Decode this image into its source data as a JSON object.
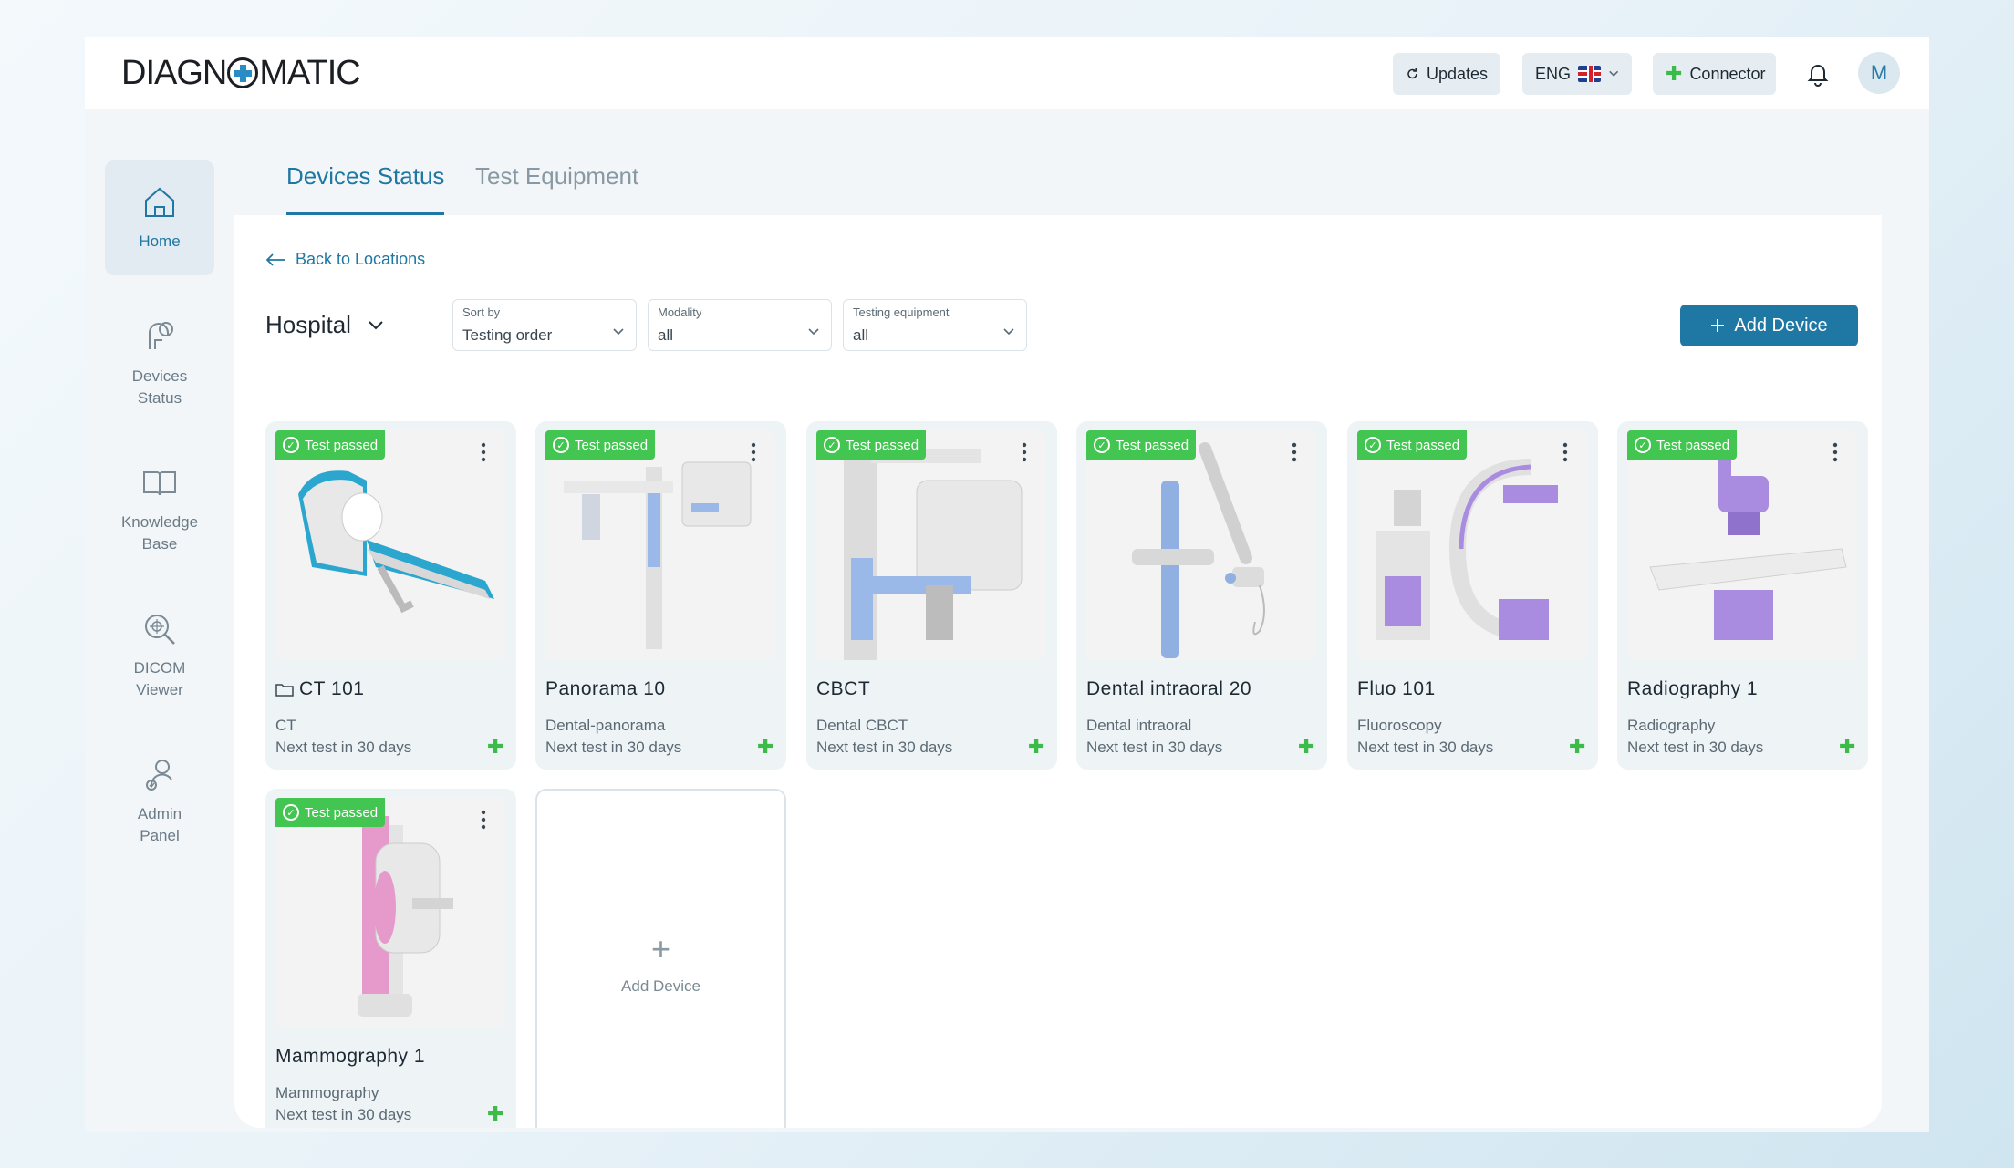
{
  "app": {
    "logo": "DIAGNOMATIC",
    "logo_prefix": "DIAGN",
    "logo_suffix": "MATIC"
  },
  "topbar": {
    "updates_label": "Updates",
    "lang_label": "ENG",
    "connector_label": "Connector",
    "avatar_initial": "M"
  },
  "sidebar": {
    "items": [
      {
        "label": "Home",
        "icon": "home-icon"
      },
      {
        "label": "Devices Status",
        "icon": "devices-status-icon"
      },
      {
        "label": "Knowledge Base",
        "icon": "book-icon"
      },
      {
        "label": "DICOM Viewer",
        "icon": "dicom-viewer-icon"
      },
      {
        "label": "Admin Panel",
        "icon": "admin-panel-icon"
      }
    ]
  },
  "tabs": [
    "Devices Status",
    "Test Equipment"
  ],
  "back_link": "Back to Locations",
  "location": "Hospital",
  "filters": {
    "sort_by": {
      "label": "Sort by",
      "value": "Testing order"
    },
    "modality": {
      "label": "Modality",
      "value": "all"
    },
    "testing_equipment": {
      "label": "Testing equipment",
      "value": "all"
    }
  },
  "add_device_button": "Add Device",
  "devices": [
    {
      "name": "CT 101",
      "modality": "CT",
      "next_test": "Next test in 30 days",
      "status": "Test passed",
      "accent": "#2ba6cf"
    },
    {
      "name": "Panorama 10",
      "modality": "Dental-panorama",
      "next_test": "Next test in 30 days",
      "status": "Test passed",
      "accent": "#7ea6e0"
    },
    {
      "name": "CBCT",
      "modality": "Dental CBCT",
      "next_test": "Next test in 30 days",
      "status": "Test passed",
      "accent": "#8fb0e0"
    },
    {
      "name": "Dental intraoral 20",
      "modality": "Dental intraoral",
      "next_test": "Next test in 30 days",
      "status": "Test passed",
      "accent": "#8fb0e0"
    },
    {
      "name": "Fluo 101",
      "modality": "Fluoroscopy",
      "next_test": "Next test in 30 days",
      "status": "Test passed",
      "accent": "#a98ce0"
    },
    {
      "name": "Radiography 1",
      "modality": "Radiography",
      "next_test": "Next test in 30 days",
      "status": "Test passed",
      "accent": "#a98ce0"
    },
    {
      "name": "Mammography 1",
      "modality": "Mammography",
      "next_test": "Next test in 30 days",
      "status": "Test passed",
      "accent": "#e59acb"
    }
  ],
  "add_card_label": "Add Device"
}
